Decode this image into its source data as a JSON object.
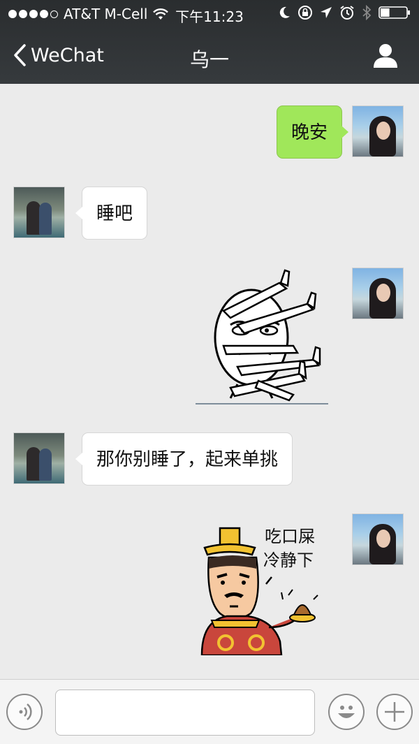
{
  "status_bar": {
    "carrier": "AT&T M-Cell",
    "time": "下午11:23",
    "signal_bars_filled": 4,
    "signal_bars_total": 5,
    "icons": [
      "wifi-icon",
      "moon-icon",
      "rotation-lock-icon",
      "location-icon",
      "alarm-icon",
      "bluetooth-icon",
      "battery-icon"
    ],
    "battery_level": 0.35
  },
  "nav": {
    "back_label": "WeChat",
    "title": "乌一",
    "right_icon": "profile-icon"
  },
  "messages": [
    {
      "from": "me",
      "type": "text",
      "text": "晚安"
    },
    {
      "from": "them",
      "type": "text",
      "text": "睡吧"
    },
    {
      "from": "me",
      "type": "sticker",
      "sticker": "middle-finger-rage-face"
    },
    {
      "from": "them",
      "type": "text",
      "text": "那你别睡了，起来单挑"
    },
    {
      "from": "me",
      "type": "sticker",
      "sticker": "emperor-eat-poop",
      "sticker_text": [
        "吃口屎",
        "冷静下"
      ]
    }
  ],
  "input_bar": {
    "voice_icon": "voice-icon",
    "text_value": "",
    "emoji_icon": "emoji-icon",
    "add_icon": "plus-icon"
  },
  "colors": {
    "nav_background": "#2f3235",
    "chat_background": "#ebebeb",
    "outgoing_bubble": "#a0e75a",
    "incoming_bubble": "#ffffff"
  }
}
